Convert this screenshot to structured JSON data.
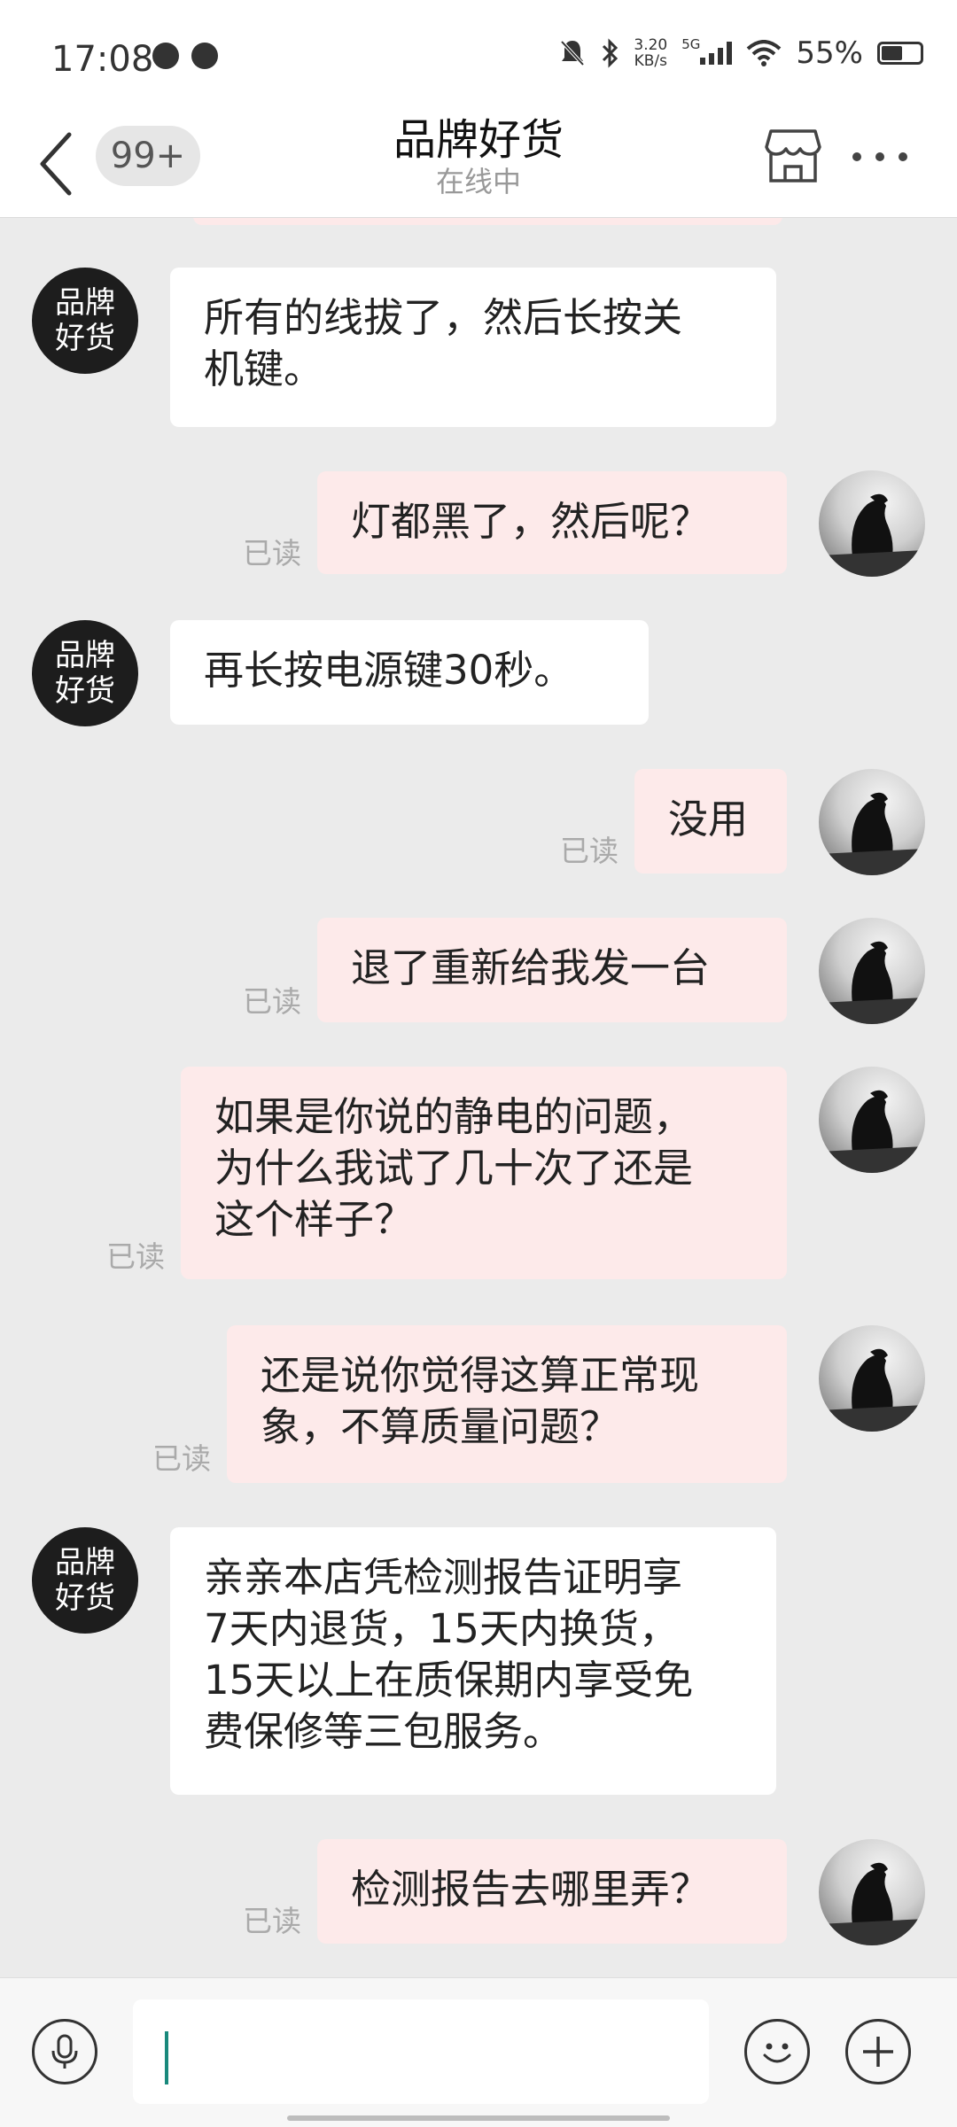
{
  "status_bar": {
    "time": "17:08",
    "speed": "3.20",
    "speed_unit": "KB/s",
    "network": "5G",
    "battery": "55%",
    "battery_level": 0.55
  },
  "header": {
    "unread_badge": "99+",
    "title": "品牌好货",
    "status": "在线中"
  },
  "shop_avatar_text": "品牌\n好货",
  "read_label": "已读",
  "messages": [
    {
      "side": "in",
      "text": "所有的线拔了，然后长按关\n机键。"
    },
    {
      "side": "out",
      "text": "灯都黑了，然后呢？",
      "read": "已读"
    },
    {
      "side": "in",
      "text": "再长按电源键30秒。"
    },
    {
      "side": "out",
      "text": "没用",
      "read": "已读"
    },
    {
      "side": "out",
      "text": "退了重新给我发一台",
      "read": "已读"
    },
    {
      "side": "out",
      "text": "如果是你说的静电的问题，\n为什么我试了几十次了还是\n这个样子？",
      "read": "已读"
    },
    {
      "side": "out",
      "text": "还是说你觉得这算正常现\n象，不算质量问题？",
      "read": "已读"
    },
    {
      "side": "in",
      "text": "亲亲本店凭检测报告证明享\n7天内退货，15天内换货，\n15天以上在质保期内享受免\n费保修等三包服务。"
    },
    {
      "side": "out",
      "text": "检测报告去哪里弄？",
      "read": "已读"
    }
  ],
  "input": {
    "placeholder": ""
  },
  "icons": {
    "back": "back-arrow-icon",
    "store": "store-icon",
    "more": "more-dots-icon",
    "voice": "microphone-icon",
    "emoji": "emoji-icon",
    "add": "plus-icon"
  }
}
